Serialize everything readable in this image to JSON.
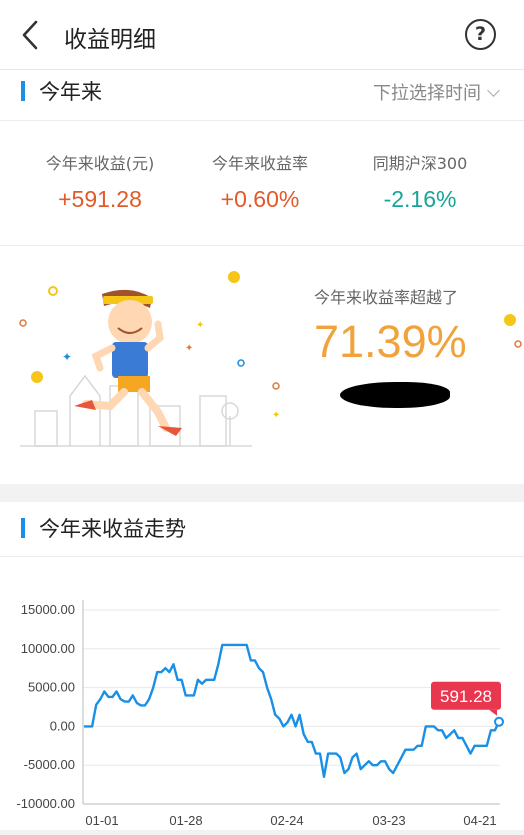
{
  "header": {
    "title": "收益明细"
  },
  "ytd": {
    "title": "今年来",
    "time_select": "下拉选择时间"
  },
  "stats": [
    {
      "label": "今年来收益(元)",
      "value": "+591.28",
      "color": "#e05a2a"
    },
    {
      "label": "今年来收益率",
      "value": "+0.60%",
      "color": "#e05a2a"
    },
    {
      "label": "同期沪深300",
      "value": "-2.16%",
      "color": "#16a596"
    }
  ],
  "promo": {
    "beat_label": "今年来收益率超越了",
    "beat_value": "71.39%"
  },
  "trend": {
    "title": "今年来收益走势"
  },
  "chart_data": {
    "type": "line",
    "y_ticks": [
      "15000.00",
      "10000.00",
      "5000.00",
      "0.00",
      "-5000.00",
      "-10000.00"
    ],
    "ylim": [
      -10000,
      15000
    ],
    "x_ticks": [
      "01-01",
      "01-28",
      "02-24",
      "03-23",
      "04-21"
    ],
    "series": [
      {
        "color": "#1a8fe6",
        "values": [
          0,
          0,
          0,
          2800,
          3500,
          4500,
          3800,
          3800,
          4500,
          3500,
          3200,
          3200,
          4000,
          3000,
          2700,
          2700,
          3500,
          5000,
          7000,
          7000,
          7500,
          7000,
          8000,
          6000,
          6000,
          4000,
          4000,
          4000,
          6000,
          5500,
          6000,
          6000,
          6000,
          8000,
          10500,
          10500,
          10500,
          10500,
          10500,
          10500,
          10500,
          8500,
          8500,
          7500,
          7000,
          5000,
          3500,
          1500,
          1000,
          0,
          500,
          1500,
          0,
          1500,
          -1000,
          -2000,
          -2000,
          -3500,
          -3500,
          -6500,
          -3500,
          -3500,
          -3500,
          -4000,
          -6000,
          -5500,
          -4000,
          -3500,
          -5500,
          -5000,
          -4500,
          -5000,
          -5000,
          -4500,
          -4500,
          -5500,
          -6000,
          -5000,
          -4000,
          -3000,
          -3000,
          -3000,
          -2500,
          -2500,
          0,
          0,
          0,
          -500,
          -500,
          -1500,
          -1000,
          -500,
          -1500,
          -1500,
          -2500,
          -3500,
          -2500,
          -2500,
          -2500,
          -2500,
          -500,
          -500,
          591.28
        ]
      }
    ],
    "last_value_label": "591.28",
    "grid": true
  }
}
